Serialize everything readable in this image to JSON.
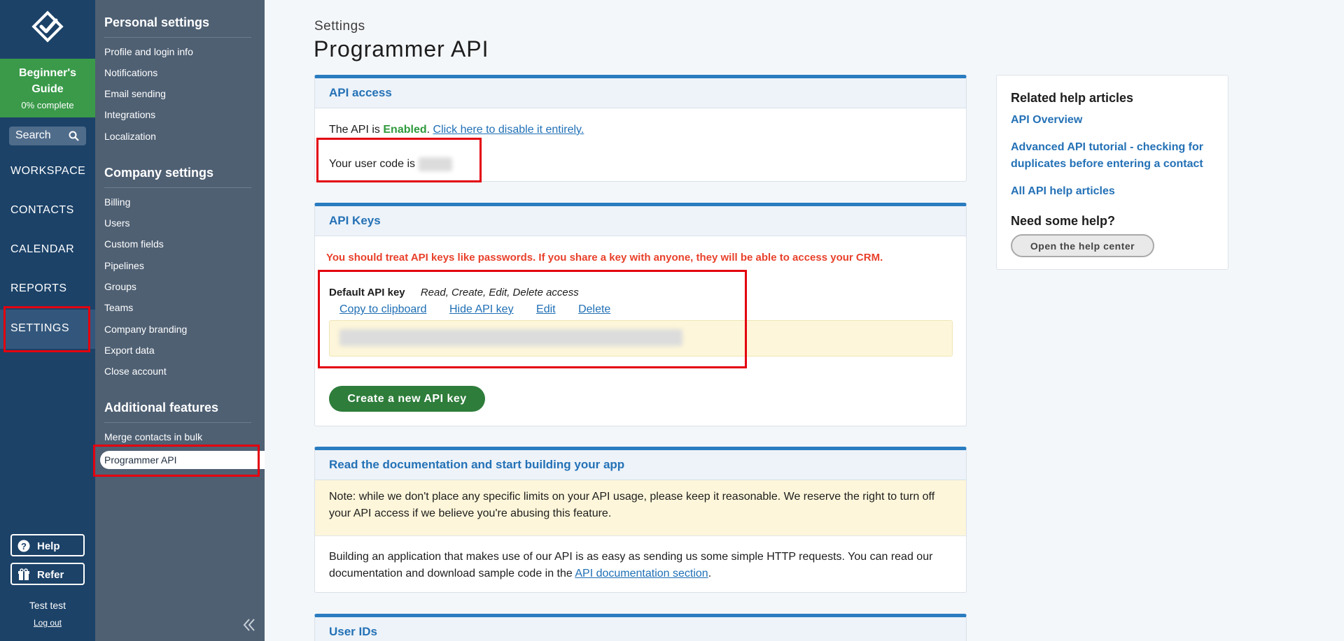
{
  "nav": {
    "guide": {
      "title_line1": "Beginner's",
      "title_line2": "Guide",
      "progress": "0% complete"
    },
    "search_label": "Search",
    "items": [
      "WORKSPACE",
      "CONTACTS",
      "CALENDAR",
      "REPORTS",
      "SETTINGS"
    ],
    "active_item": "SETTINGS",
    "help_label": "Help",
    "refer_label": "Refer",
    "user_name": "Test test",
    "logout_label": "Log out"
  },
  "menu": {
    "personal_title": "Personal settings",
    "personal_items": [
      "Profile and login info",
      "Notifications",
      "Email sending",
      "Integrations",
      "Localization"
    ],
    "company_title": "Company settings",
    "company_items": [
      "Billing",
      "Users",
      "Custom fields",
      "Pipelines",
      "Groups",
      "Teams",
      "Company branding",
      "Export data",
      "Close account"
    ],
    "additional_title": "Additional features",
    "additional_items": [
      "Merge contacts in bulk",
      "Programmer API"
    ],
    "active_item": "Programmer API"
  },
  "page": {
    "breadcrumb": "Settings",
    "title": "Programmer API"
  },
  "api_access": {
    "heading": "API access",
    "status_prefix": "The API is ",
    "status_value": "Enabled",
    "status_suffix": ".",
    "disable_link": "Click here to disable it entirely.",
    "user_code_label": "Your user code is"
  },
  "api_keys": {
    "heading": "API Keys",
    "warning": "You should treat API keys like passwords. If you share a key with anyone, they will be able to access your CRM.",
    "key_name": "Default API key",
    "key_access": "Read, Create, Edit, Delete access",
    "actions": {
      "copy": "Copy to clipboard",
      "hide": "Hide API key",
      "edit": "Edit",
      "delete": "Delete"
    },
    "create_button": "Create a new API key"
  },
  "docs": {
    "heading": "Read the documentation and start building your app",
    "note": "Note: while we don't place any specific limits on your API usage, please keep it reasonable. We reserve the right to turn off your API access if we believe you're abusing this feature.",
    "body_prefix": "Building an application that makes use of our API is as easy as sending us some simple HTTP requests. You can read our documentation and download sample code in the ",
    "body_link": "API documentation section",
    "body_suffix": "."
  },
  "user_ids": {
    "heading": "User IDs"
  },
  "help_box": {
    "related_title": "Related help articles",
    "links": [
      "API Overview",
      "Advanced API tutorial - checking for duplicates before entering a contact",
      "All API help articles"
    ],
    "need_help_title": "Need some help?",
    "help_center_button": "Open the help center"
  },
  "colors": {
    "nav_bg": "#1c4268",
    "menu_bg": "#4f6073",
    "guide_green": "#3a9a4a",
    "card_accent": "#2a7cc0",
    "warning_red": "#e8412b",
    "create_green": "#2e7d3b",
    "highlight_red": "#e3000f"
  }
}
